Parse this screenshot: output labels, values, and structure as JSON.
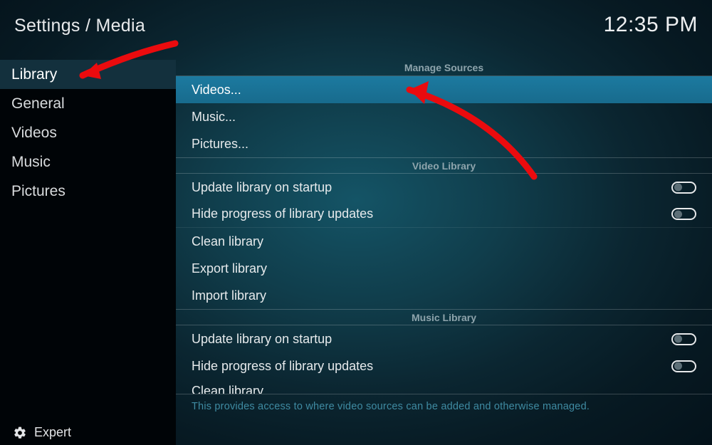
{
  "header": {
    "breadcrumb": "Settings / Media",
    "clock": "12:35 PM"
  },
  "sidebar": {
    "items": [
      {
        "label": "Library",
        "selected": true
      },
      {
        "label": "General",
        "selected": false
      },
      {
        "label": "Videos",
        "selected": false
      },
      {
        "label": "Music",
        "selected": false
      },
      {
        "label": "Pictures",
        "selected": false
      }
    ],
    "level": "Expert"
  },
  "content": {
    "sections": [
      {
        "title": "Manage Sources",
        "rows": [
          {
            "label": "Videos...",
            "type": "link",
            "highlight": true
          },
          {
            "label": "Music...",
            "type": "link"
          },
          {
            "label": "Pictures...",
            "type": "link"
          }
        ]
      },
      {
        "title": "Video Library",
        "rows": [
          {
            "label": "Update library on startup",
            "type": "toggle",
            "value": false
          },
          {
            "label": "Hide progress of library updates",
            "type": "toggle",
            "value": false
          },
          {
            "label": "Clean library",
            "type": "link"
          },
          {
            "label": "Export library",
            "type": "link"
          },
          {
            "label": "Import library",
            "type": "link"
          }
        ]
      },
      {
        "title": "Music Library",
        "rows": [
          {
            "label": "Update library on startup",
            "type": "toggle",
            "value": false
          },
          {
            "label": "Hide progress of library updates",
            "type": "toggle",
            "value": false
          },
          {
            "label": "Clean library",
            "type": "link",
            "clipped": true
          }
        ]
      }
    ]
  },
  "footer": {
    "hint": "This provides access to where video sources can be added and otherwise managed."
  },
  "colors": {
    "highlight": "#1c7a9e",
    "annotation": "#ea0b0e"
  }
}
